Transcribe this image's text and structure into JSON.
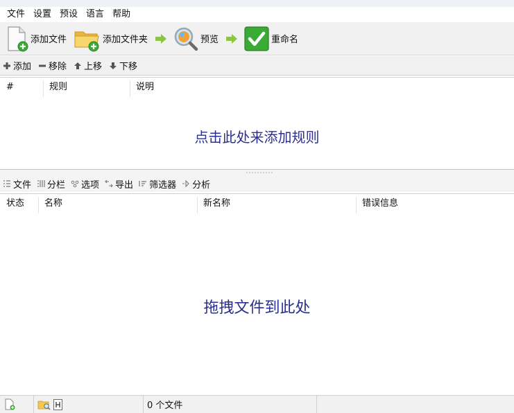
{
  "menu": {
    "items": [
      "文件",
      "设置",
      "预设",
      "语言",
      "帮助"
    ]
  },
  "toolbar": {
    "add_files_label": "添加文件",
    "add_folders_label": "添加文件夹",
    "preview_label": "预览",
    "rename_label": "重命名"
  },
  "rules_toolbar": {
    "add_label": "添加",
    "remove_label": "移除",
    "up_label": "上移",
    "down_label": "下移"
  },
  "rules_table": {
    "columns": [
      "#",
      "规则",
      "说明"
    ],
    "empty_hint": "点击此处来添加规则"
  },
  "files_toolbar": {
    "files_label": "文件",
    "columns_label": "分栏",
    "options_label": "选项",
    "export_label": "导出",
    "filters_label": "筛选器",
    "analyze_label": "分析"
  },
  "files_table": {
    "columns": [
      "状态",
      "名称",
      "新名称",
      "错误信息"
    ],
    "empty_hint": "拖拽文件到此处"
  },
  "status": {
    "file_count": "0 个文件"
  },
  "colors": {
    "hint_text": "#2b2f8f",
    "rename_green": "#3aaa35",
    "arrow_green": "#8cc63f",
    "folder_yellow": "#f2c94c"
  }
}
